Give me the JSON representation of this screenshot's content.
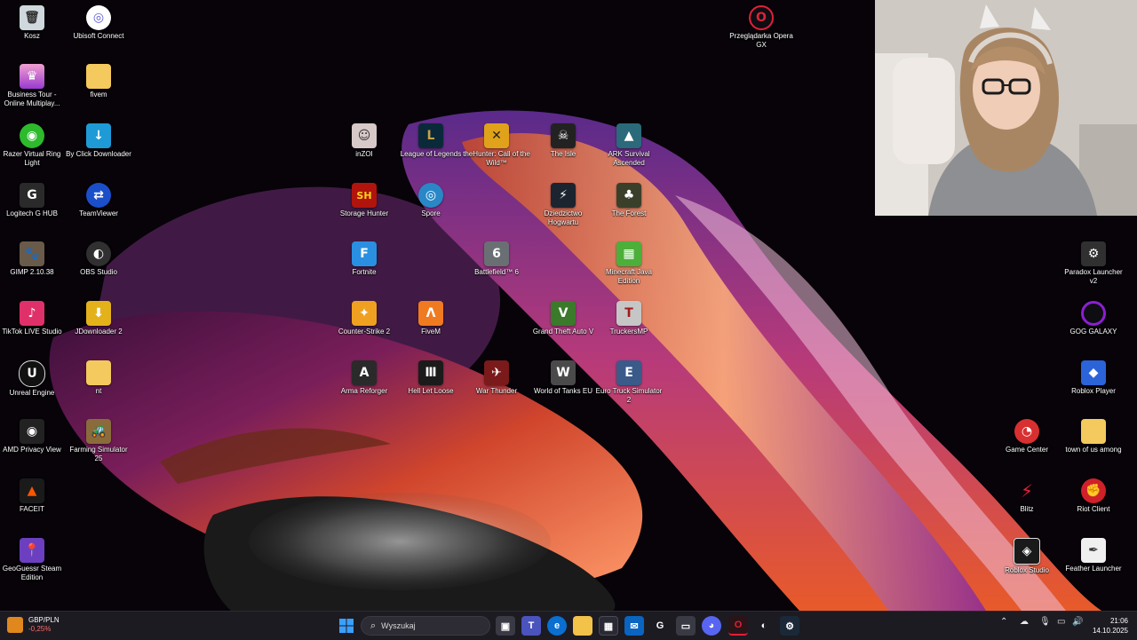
{
  "desktop": {
    "icons": [
      {
        "label": "Kosz",
        "name": "recycle-bin-icon",
        "glyph": "🗑",
        "color": "#cfd8dc"
      },
      {
        "label": "Ubisoft Connect",
        "name": "ubisoft-connect-icon",
        "glyph": "◎",
        "color": "#5b5bd6"
      },
      {
        "label": "Business Tour - Online Multiplay...",
        "name": "business-tour-icon",
        "glyph": "♛",
        "color": "#d25aa0"
      },
      {
        "label": "fivem",
        "name": "folder-icon",
        "glyph": "",
        "color": "#f4c95d"
      },
      {
        "label": "Razer Virtual Ring Light",
        "name": "razer-icon",
        "glyph": "◉",
        "color": "#2dba2d"
      },
      {
        "label": "By Click Downloader",
        "name": "byclick-icon",
        "glyph": "↓",
        "color": "#1e9bd7"
      },
      {
        "label": "Logitech G HUB",
        "name": "logitech-icon",
        "glyph": "G",
        "color": "#2a2a2a"
      },
      {
        "label": "TeamViewer",
        "name": "teamviewer-icon",
        "glyph": "⇄",
        "color": "#1a4fc9"
      },
      {
        "label": "GIMP 2.10.38",
        "name": "gimp-icon",
        "glyph": "🐾",
        "color": "#6a5a4a"
      },
      {
        "label": "OBS Studio",
        "name": "obs-icon",
        "glyph": "◐",
        "color": "#303030"
      },
      {
        "label": "TikTok LIVE Studio",
        "name": "tiktok-icon",
        "glyph": "♪",
        "color": "#e0306a"
      },
      {
        "label": "JDownloader 2",
        "name": "jdownloader-icon",
        "glyph": "⬇",
        "color": "#e3b21b"
      },
      {
        "label": "Unreal Engine",
        "name": "unreal-icon",
        "glyph": "U",
        "color": "#111111"
      },
      {
        "label": "nt",
        "name": "folder-icon",
        "glyph": "",
        "color": "#f4c95d"
      },
      {
        "label": "AMD Privacy View",
        "name": "amd-icon",
        "glyph": "◉",
        "color": "#222222"
      },
      {
        "label": "Farming Simulator 25",
        "name": "farming-sim-icon",
        "glyph": "🚜",
        "color": "#8a6b3b"
      },
      {
        "label": "FACEIT",
        "name": "faceit-icon",
        "glyph": "▲",
        "color": "#ff5500"
      },
      {
        "label": "GeoGuessr Steam Edition",
        "name": "geoguessr-icon",
        "glyph": "📍",
        "color": "#6c3fc0"
      },
      {
        "label": "inZOI",
        "name": "inzoi-icon",
        "glyph": "☺",
        "color": "#d8c9c9"
      },
      {
        "label": "League of Legends",
        "name": "league-icon",
        "glyph": "L",
        "color": "#0a2a3a"
      },
      {
        "label": "theHunter: Call of the Wild™",
        "name": "thehunter-icon",
        "glyph": "✕",
        "color": "#e0a21a"
      },
      {
        "label": "The Isle",
        "name": "the-isle-icon",
        "glyph": "☠",
        "color": "#222222"
      },
      {
        "label": "ARK Survival Ascended",
        "name": "ark-icon",
        "glyph": "▲",
        "color": "#2a6a7a"
      },
      {
        "label": "Storage Hunter",
        "name": "storage-hunter-icon",
        "glyph": "SH",
        "color": "#b0140c"
      },
      {
        "label": "Spore",
        "name": "spore-icon",
        "glyph": "◎",
        "color": "#2a87c7"
      },
      {
        "label": "Dziedzictwo Hogwartu",
        "name": "hogwarts-icon",
        "glyph": "⚡",
        "color": "#1c2430"
      },
      {
        "label": "The Forest",
        "name": "the-forest-icon",
        "glyph": "♣",
        "color": "#3a3f2a"
      },
      {
        "label": "Fortnite",
        "name": "fortnite-icon",
        "glyph": "F",
        "color": "#2a8fe0"
      },
      {
        "label": "Battlefield™ 6",
        "name": "battlefield-icon",
        "glyph": "6",
        "color": "#6a6f74"
      },
      {
        "label": "Minecraft Java Edition",
        "name": "minecraft-icon",
        "glyph": "▦",
        "color": "#4caf3a"
      },
      {
        "label": "Counter-Strike 2",
        "name": "cs2-icon",
        "glyph": "✦",
        "color": "#f0a020"
      },
      {
        "label": "FiveM",
        "name": "fivem-app-icon",
        "glyph": "Λ",
        "color": "#f07a20"
      },
      {
        "label": "Grand Theft Auto V",
        "name": "gta-icon",
        "glyph": "V",
        "color": "#3a7a2a"
      },
      {
        "label": "TruckersMP",
        "name": "truckersmp-icon",
        "glyph": "T",
        "color": "#c6c6c6"
      },
      {
        "label": "Arma Reforger",
        "name": "arma-icon",
        "glyph": "A",
        "color": "#2a2a2a"
      },
      {
        "label": "Hell Let Loose",
        "name": "hell-let-loose-icon",
        "glyph": "Ⅲ",
        "color": "#1b1b1b"
      },
      {
        "label": "War Thunder",
        "name": "war-thunder-icon",
        "glyph": "✈",
        "color": "#7a1a1a"
      },
      {
        "label": "World of Tanks EU",
        "name": "wot-icon",
        "glyph": "W",
        "color": "#4a4a4a"
      },
      {
        "label": "Euro Truck Simulator 2",
        "name": "ets2-icon",
        "glyph": "E",
        "color": "#3a5a8a"
      },
      {
        "label": "Przeglądarka Opera GX",
        "name": "opera-gx-icon",
        "glyph": "O",
        "color": "#c40a2a"
      },
      {
        "label": "Paradox Launcher v2",
        "name": "paradox-icon",
        "glyph": "⚙",
        "color": "#303030"
      },
      {
        "label": "GOG GALAXY",
        "name": "gog-icon",
        "glyph": "◯",
        "color": "#8b1fd0"
      },
      {
        "label": "Roblox Player",
        "name": "roblox-player-icon",
        "glyph": "◆",
        "color": "#2b63d8"
      },
      {
        "label": "Game Center",
        "name": "game-center-icon",
        "glyph": "◔",
        "color": "#d83030"
      },
      {
        "label": "town of us among",
        "name": "folder-icon",
        "glyph": "",
        "color": "#f4c95d"
      },
      {
        "label": "Blitz",
        "name": "blitz-icon",
        "glyph": "⚡",
        "color": "#e8203a"
      },
      {
        "label": "Riot Client",
        "name": "riot-client-icon",
        "glyph": "✊",
        "color": "#d0202a"
      },
      {
        "label": "Roblox Studio",
        "name": "roblox-studio-icon",
        "glyph": "◈",
        "color": "#1a1a1a"
      },
      {
        "label": "Feather Launcher",
        "name": "feather-icon",
        "glyph": "✒",
        "color": "#f0f0f0"
      }
    ]
  },
  "taskbar": {
    "widget": {
      "line1": "GBP/PLN",
      "line2": "-0,25%"
    },
    "search_placeholder": "Wyszukaj",
    "clock_time": "21:06",
    "clock_date": "14.10.2025"
  }
}
